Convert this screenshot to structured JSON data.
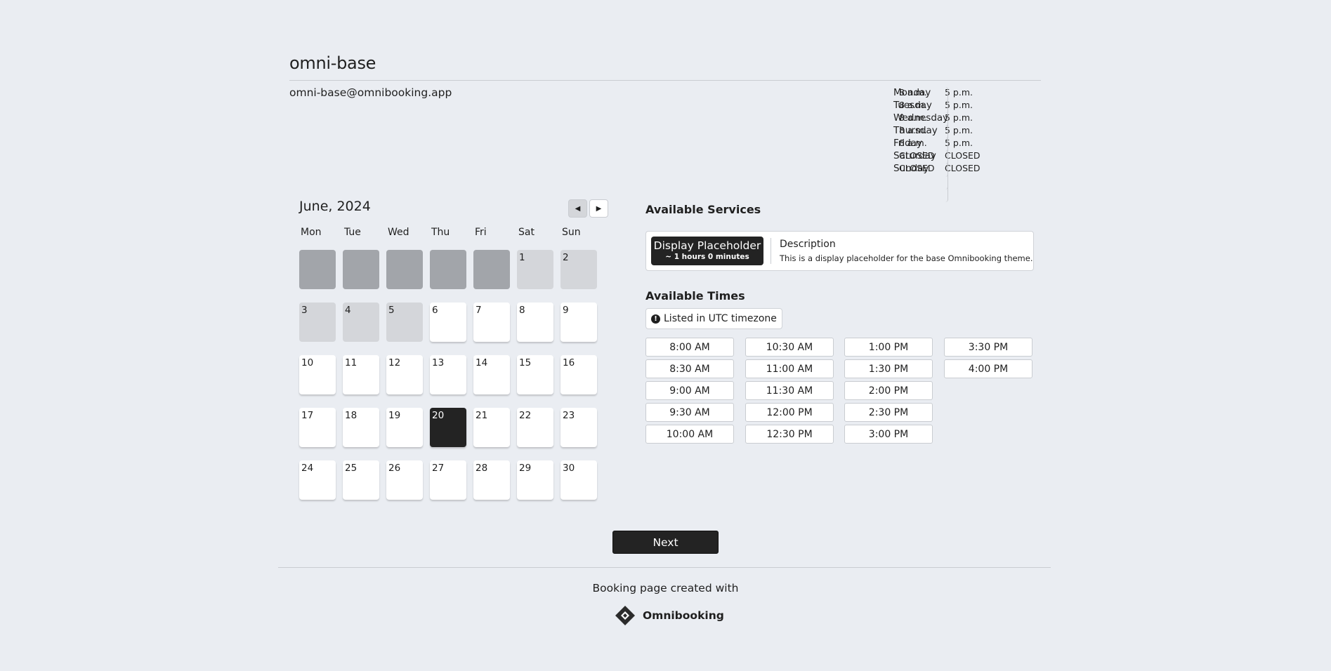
{
  "header": {
    "title": "omni-base",
    "email": "omni-base@omnibooking.app"
  },
  "hours": [
    {
      "day": "Monday",
      "open": "8 a.m.",
      "close": "5 p.m."
    },
    {
      "day": "Tuesday",
      "open": "8 a.m.",
      "close": "5 p.m."
    },
    {
      "day": "Wednesday",
      "open": "8 a.m.",
      "close": "5 p.m."
    },
    {
      "day": "Thursday",
      "open": "8 a.m.",
      "close": "5 p.m."
    },
    {
      "day": "Friday",
      "open": "8 a.m.",
      "close": "5 p.m."
    },
    {
      "day": "Saturday",
      "open": "CLOSED",
      "close": "CLOSED"
    },
    {
      "day": "Sunday",
      "open": "CLOSED",
      "close": "CLOSED"
    }
  ],
  "calendar": {
    "month_label": "June, 2024",
    "prev_icon": "triangle-left-icon",
    "next_icon": "triangle-right-icon",
    "weekdays": [
      "Mon",
      "Tue",
      "Wed",
      "Thu",
      "Fri",
      "Sat",
      "Sun"
    ],
    "selected_day": "20",
    "days": [
      "",
      "",
      "",
      "",
      "",
      "1",
      "2",
      "3",
      "4",
      "5",
      "6",
      "7",
      "8",
      "9",
      "10",
      "11",
      "12",
      "13",
      "14",
      "15",
      "16",
      "17",
      "18",
      "19",
      "20",
      "21",
      "22",
      "23",
      "24",
      "25",
      "26",
      "27",
      "28",
      "29",
      "30"
    ],
    "past_days": [
      "1",
      "2",
      "3",
      "4",
      "5"
    ]
  },
  "services": {
    "heading": "Available Services",
    "item": {
      "name": "Display Placeholder",
      "duration": "~ 1 hours 0 minutes",
      "desc_title": "Description",
      "desc": "This is a display placeholder for the base Omnibooking theme."
    }
  },
  "times": {
    "heading": "Available Times",
    "timezone_note": "Listed in UTC timezone",
    "timezone_icon": "exclamation-circle-icon",
    "columns": [
      [
        "8:00 AM",
        "8:30 AM",
        "9:00 AM",
        "9:30 AM",
        "10:00 AM"
      ],
      [
        "10:30 AM",
        "11:00 AM",
        "11:30 AM",
        "12:00 PM",
        "12:30 PM"
      ],
      [
        "1:00 PM",
        "1:30 PM",
        "2:00 PM",
        "2:30 PM",
        "3:00 PM"
      ],
      [
        "3:30 PM",
        "4:00 PM"
      ]
    ]
  },
  "actions": {
    "next_label": "Next"
  },
  "footer": {
    "created_with": "Booking page created with",
    "brand": "Omnibooking",
    "brand_icon": "omnibooking-logo-icon"
  }
}
